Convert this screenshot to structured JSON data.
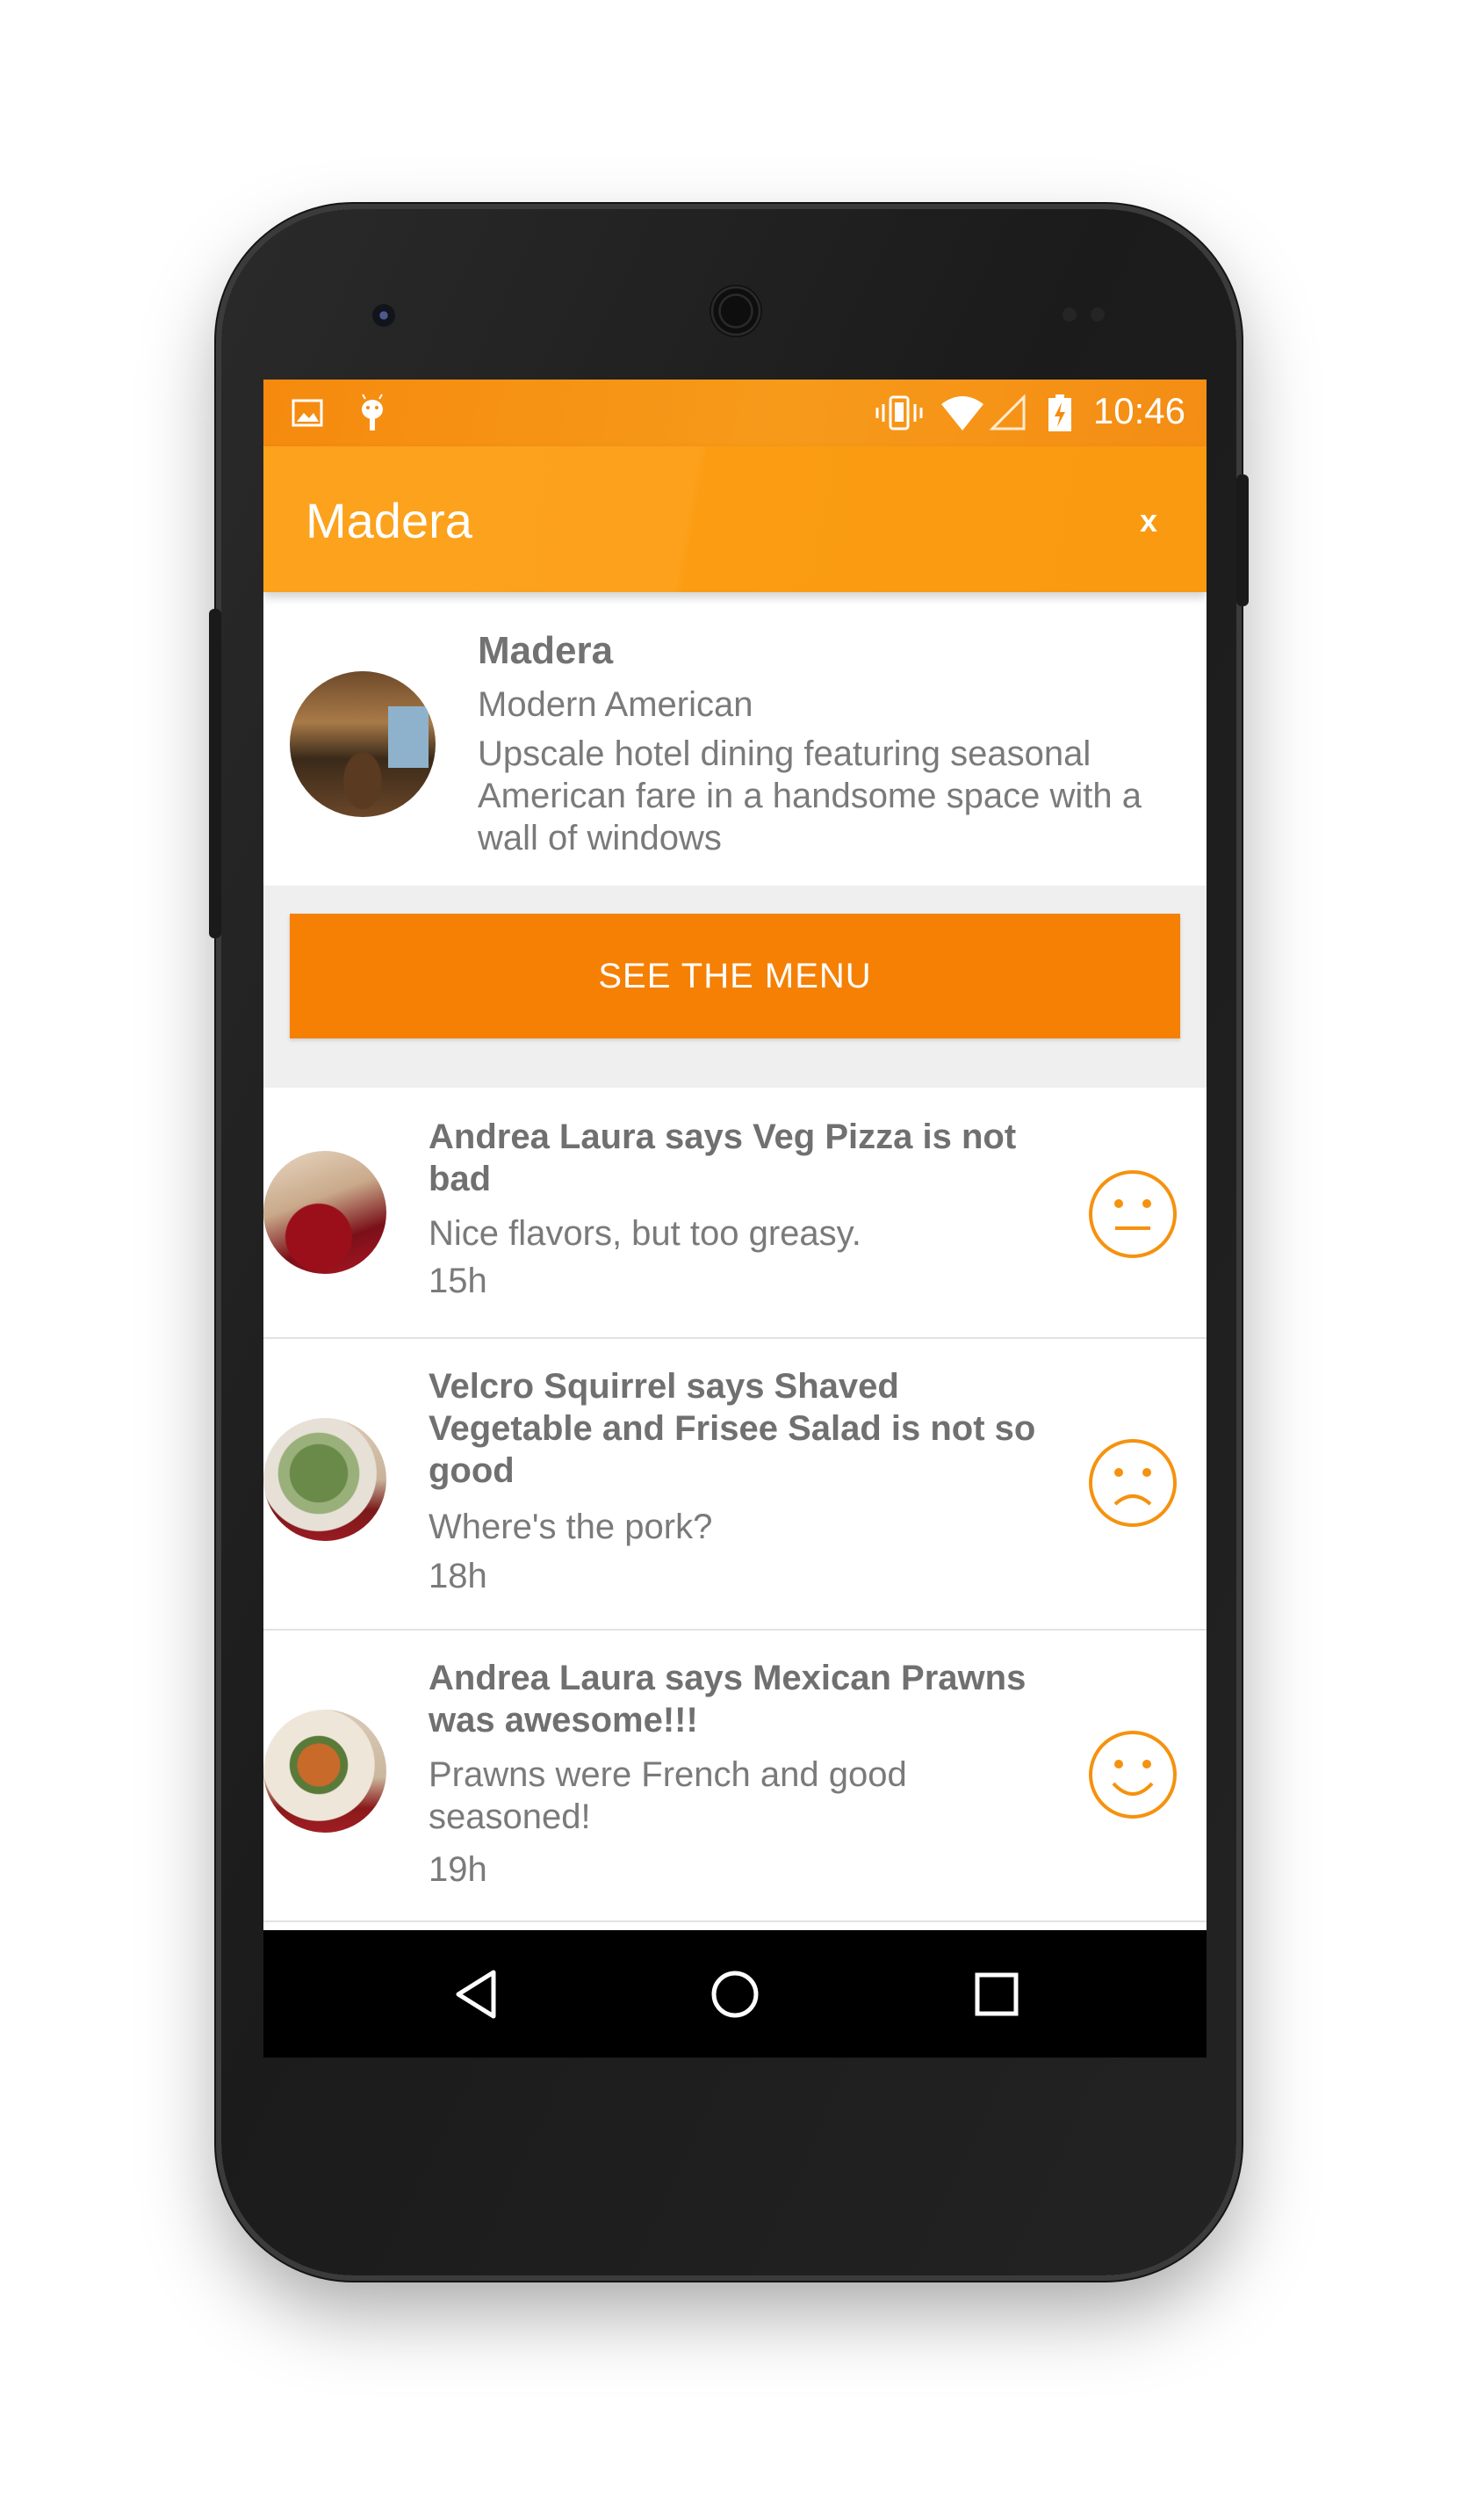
{
  "status_bar": {
    "time": "10:46",
    "icons": [
      "image-icon",
      "android-icon",
      "vibrate-icon",
      "wifi-icon",
      "signal-icon",
      "battery-charging-icon"
    ]
  },
  "app_bar": {
    "title": "Madera",
    "close_label": "x"
  },
  "restaurant": {
    "name": "Madera",
    "cuisine": "Modern American",
    "description": "Upscale hotel dining featuring seasonal American fare in a handsome space with a wall of windows"
  },
  "menu_button": {
    "label": "SEE THE MENU"
  },
  "reviews": [
    {
      "title": "Andrea Laura says Veg Pizza is not bad",
      "body": "Nice flavors, but too greasy.",
      "time": "15h",
      "sentiment": "neutral-face-icon"
    },
    {
      "title": "Velcro Squirrel says Shaved Vegetable and Frisee Salad is not so good",
      "body": "Where's the pork?",
      "time": "18h",
      "sentiment": "sad-face-icon"
    },
    {
      "title": "Andrea Laura says Mexican Prawns was awesome!!!",
      "body": "Prawns were French and good seasoned!",
      "time": "19h",
      "sentiment": "happy-face-icon"
    }
  ],
  "colors": {
    "primary": "#fb9c12",
    "accent": "#f58004",
    "status_bar": "#f58a0e",
    "text": "#7a7a7a"
  },
  "nav_bar": {
    "icons": [
      "back-icon",
      "home-icon",
      "recents-icon"
    ]
  }
}
